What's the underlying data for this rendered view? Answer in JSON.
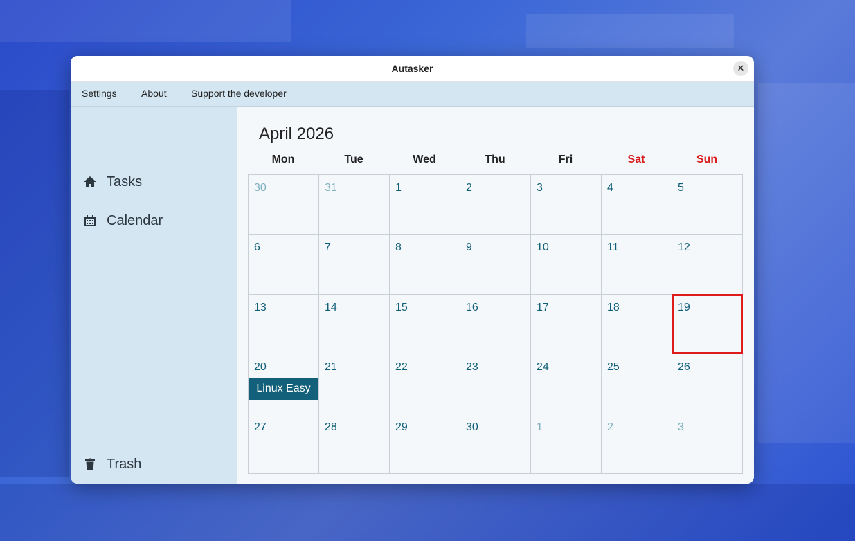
{
  "window": {
    "title": "Autasker"
  },
  "menu": {
    "items": [
      "Settings",
      "About",
      "Support the developer"
    ]
  },
  "sidebar": {
    "items": [
      {
        "label": "Tasks",
        "icon": "home-icon"
      },
      {
        "label": "Calendar",
        "icon": "calendar-icon"
      }
    ],
    "bottom": {
      "label": "Trash",
      "icon": "trash-icon"
    }
  },
  "calendar": {
    "title": "April 2026",
    "weekdays": [
      "Mon",
      "Tue",
      "Wed",
      "Thu",
      "Fri",
      "Sat",
      "Sun"
    ],
    "weeks": [
      [
        {
          "d": "30",
          "other": true
        },
        {
          "d": "31",
          "other": true
        },
        {
          "d": "1"
        },
        {
          "d": "2"
        },
        {
          "d": "3"
        },
        {
          "d": "4"
        },
        {
          "d": "5"
        }
      ],
      [
        {
          "d": "6"
        },
        {
          "d": "7"
        },
        {
          "d": "8"
        },
        {
          "d": "9"
        },
        {
          "d": "10"
        },
        {
          "d": "11"
        },
        {
          "d": "12"
        }
      ],
      [
        {
          "d": "13"
        },
        {
          "d": "14"
        },
        {
          "d": "15"
        },
        {
          "d": "16"
        },
        {
          "d": "17"
        },
        {
          "d": "18"
        },
        {
          "d": "19",
          "today": true
        }
      ],
      [
        {
          "d": "20",
          "event": "Linux Easy"
        },
        {
          "d": "21"
        },
        {
          "d": "22"
        },
        {
          "d": "23"
        },
        {
          "d": "24"
        },
        {
          "d": "25"
        },
        {
          "d": "26"
        }
      ],
      [
        {
          "d": "27"
        },
        {
          "d": "28"
        },
        {
          "d": "29"
        },
        {
          "d": "30"
        },
        {
          "d": "1",
          "other": true
        },
        {
          "d": "2",
          "other": true
        },
        {
          "d": "3",
          "other": true
        }
      ]
    ]
  },
  "colors": {
    "accent": "#13607a",
    "today_border": "#e01b1b",
    "weekend": "#d81e1e",
    "sidebar_bg": "#d4e6f1"
  }
}
